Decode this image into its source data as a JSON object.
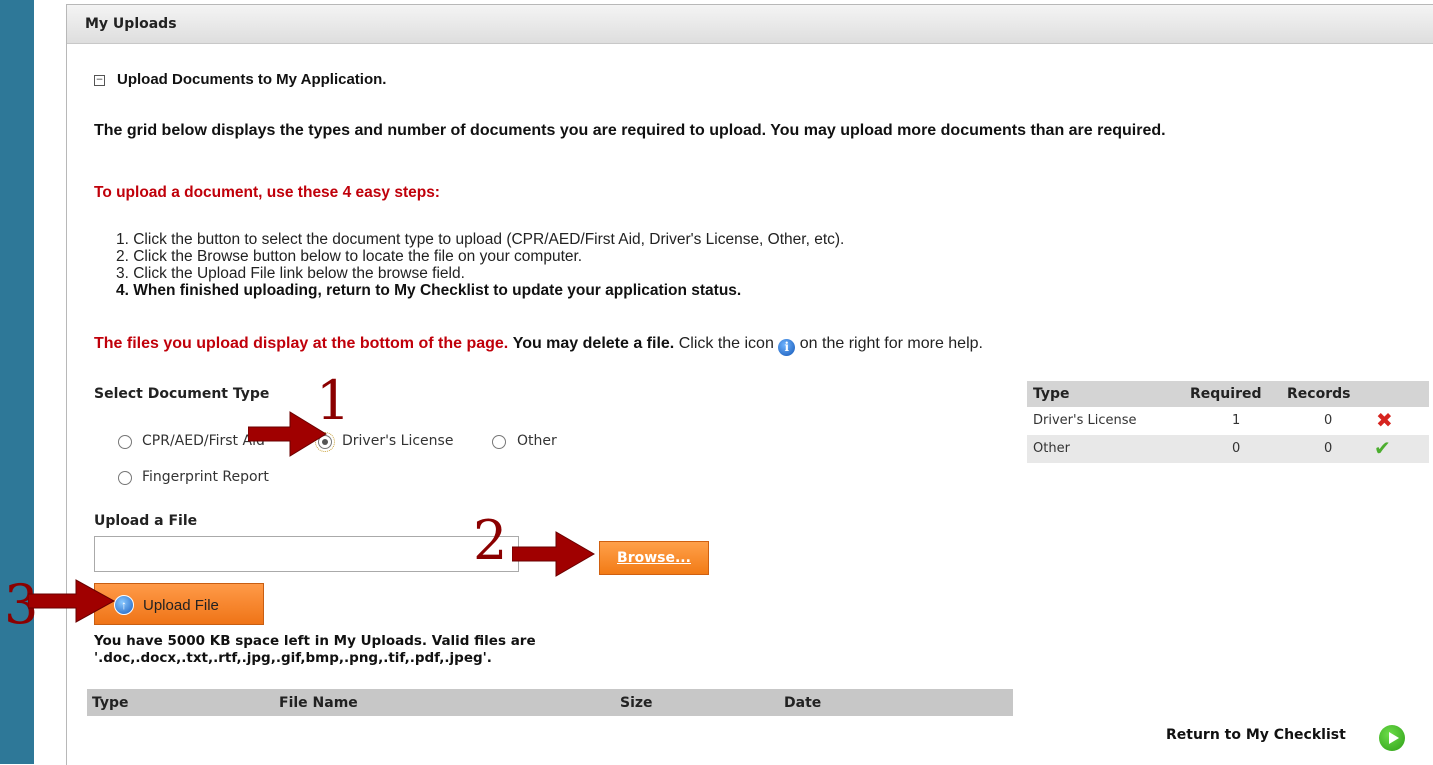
{
  "panel": {
    "title": "My Uploads"
  },
  "section": {
    "title": "Upload Documents to My Application."
  },
  "intro": {
    "text": "The grid below displays the types and number of documents you are required to upload. You may upload more documents than are required."
  },
  "steps": {
    "title": "To upload a document, use these 4 easy steps:",
    "items": [
      "1. Click the button to select the document type to upload (CPR/AED/First Aid, Driver's License, Other, etc).",
      "2. Click the Browse button below to locate the file on your computer.",
      "3. Click the Upload File link below the browse field.",
      "4. When finished uploading, return to My Checklist to update your application status."
    ]
  },
  "files_note": {
    "red": "The files you upload display at the bottom of the page.",
    "bold": "You may delete a file.",
    "before_icon": "Click the icon",
    "after_icon": "on the right for more help.",
    "icon": "info-icon"
  },
  "doc_type": {
    "label": "Select Document Type",
    "options": [
      "CPR/AED/First Aid",
      "Driver's License",
      "Other",
      "Fingerprint Report"
    ],
    "selected": "Driver's License"
  },
  "upload": {
    "label": "Upload a File",
    "file_value": "",
    "browse_label": "Browse...",
    "upload_label": "Upload File",
    "space_note_1": "You have 5000 KB space left in My Uploads. Valid files are",
    "space_note_2": "'.doc,.docx,.txt,.rtf,.jpg,.gif,bmp,.png,.tif,.pdf,.jpeg'."
  },
  "files_grid": {
    "columns": [
      "Type",
      "File Name",
      "Size",
      "Date"
    ],
    "rows": []
  },
  "requirements": {
    "columns": [
      "Type",
      "Required",
      "Records"
    ],
    "rows": [
      {
        "type": "Driver's License",
        "required": "1",
        "records": "0",
        "status": "x-icon"
      },
      {
        "type": "Other",
        "required": "0",
        "records": "0",
        "status": "check-icon"
      }
    ]
  },
  "return_link": {
    "label": "Return to My Checklist",
    "icon": "play-icon"
  },
  "annotations": {
    "step1": "1",
    "step2": "2",
    "step3": "3"
  },
  "colors": {
    "sidebar": "#2e7898",
    "accent_red": "#c0000a",
    "button_orange": "#f27b16",
    "annotation": "#8b0000"
  }
}
